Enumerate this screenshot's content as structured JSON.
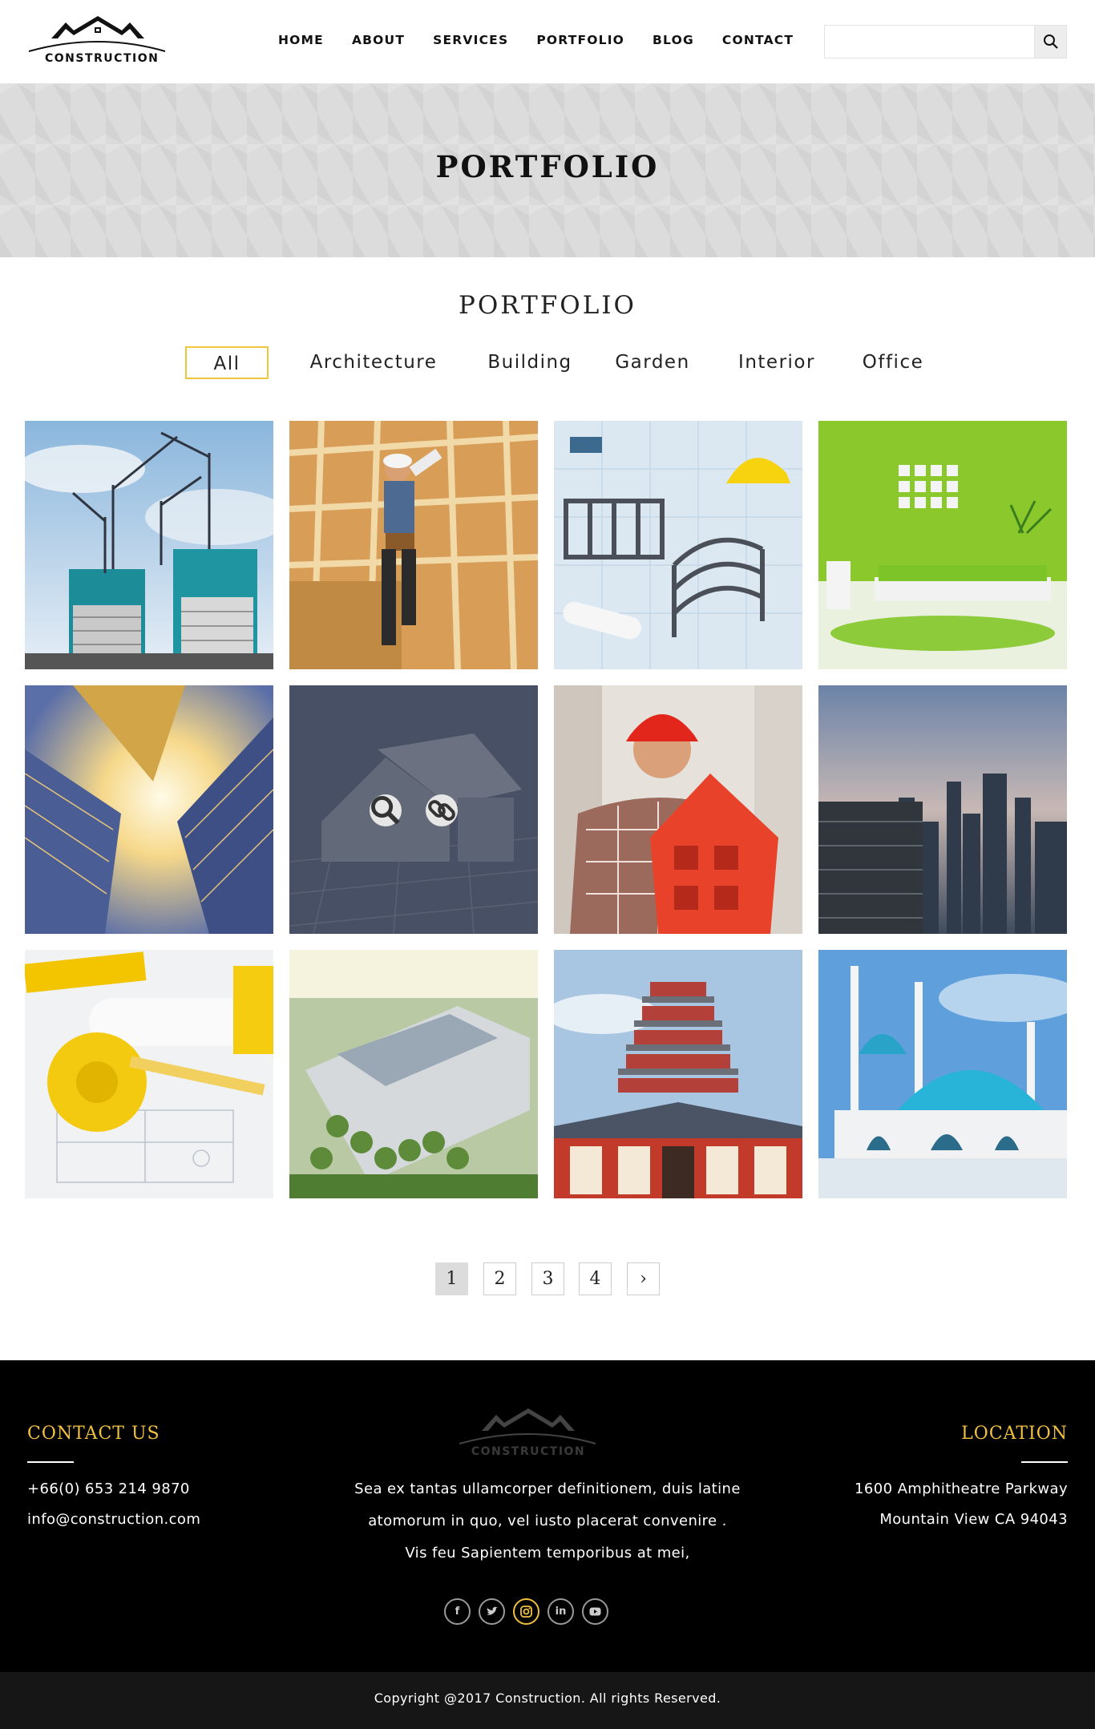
{
  "header": {
    "logo_text": "CONSTRUCTION",
    "nav": [
      "HOME",
      "ABOUT",
      "SERVICES",
      "PORTFOLIO",
      "BLOG",
      "CONTACT"
    ],
    "search": {
      "value": "",
      "placeholder": ""
    }
  },
  "hero": {
    "title": "PORTFOLIO"
  },
  "portfolio": {
    "title": "PORTFOLIO",
    "filters": [
      "All",
      "Architecture",
      "Building",
      "Garden",
      "Interior",
      "Office"
    ],
    "active_filter": "All",
    "tiles": [
      "cranes-skyscraper-image",
      "worker-timber-frame-image",
      "steel-frame-blueprint-image",
      "green-bedroom-image",
      "glass-towers-sun-image",
      "house-model-image",
      "worker-red-house-image",
      "city-skyline-image",
      "tape-measure-blueprint-image",
      "campus-aerial-image",
      "pagoda-image",
      "mosque-image"
    ]
  },
  "pagination": {
    "pages": [
      "1",
      "2",
      "3",
      "4"
    ],
    "next": "›",
    "active": "1"
  },
  "footer": {
    "contact": {
      "title": "CONTACT US",
      "phone": "+66(0) 653 214 9870",
      "email": "info@construction.com"
    },
    "logo_text": "CONSTRUCTION",
    "about_lines": [
      "Sea ex tantas ullamcorper definitionem, duis latine",
      "atomorum in quo, vel iusto placerat convenire .",
      "Vis feu Sapientem temporibus at mei,"
    ],
    "location": {
      "title": "LOCATION",
      "line1": "1600 Amphitheatre Parkway",
      "line2": "Mountain View CA 94043"
    },
    "social": [
      "facebook-icon",
      "twitter-icon",
      "instagram-icon",
      "linkedin-icon",
      "youtube-icon"
    ],
    "copyright": "Copyright @2017 Construction. All rights Reserved."
  },
  "colors": {
    "accent": "#f0c040",
    "footer_bg": "#000000",
    "copyright_bg": "#161616",
    "hero_bg": "#dcdcdc"
  }
}
